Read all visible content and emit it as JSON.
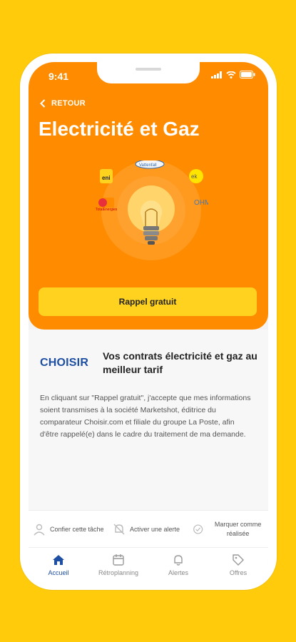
{
  "status_bar": {
    "time": "9:41"
  },
  "header": {
    "back_label": "RETOUR",
    "title": "Electricité et Gaz"
  },
  "illustration": {
    "icon": "lightbulb-icon",
    "logos": [
      "eni",
      "Vattenfall",
      "ekwateur",
      "TotalEnergies",
      "OHM"
    ]
  },
  "cta": {
    "label": "Rappel gratuit"
  },
  "offer": {
    "brand": "CHOISIR",
    "headline": "Vos contrats électricité et gaz au meilleur tarif",
    "legal": "En cliquant sur \"Rappel gratuit\", j'accepte que mes informations soient transmises à la société Marketshot, éditrice du comparateur Choisir.com et filiale du groupe La Poste, afin d'être rappelé(e) dans le cadre du traitement de ma demande."
  },
  "actions": [
    {
      "label": "Confier cette tâche",
      "icon": "person-icon"
    },
    {
      "label": "Activer une alerte",
      "icon": "bell-off-icon"
    },
    {
      "label": "Marquer comme réalisée",
      "icon": "check-circle-icon"
    }
  ],
  "tabs": [
    {
      "label": "Accueil",
      "icon": "home-icon",
      "active": true
    },
    {
      "label": "Rétroplanning",
      "icon": "calendar-icon",
      "active": false
    },
    {
      "label": "Alertes",
      "icon": "bell-icon",
      "active": false
    },
    {
      "label": "Offres",
      "icon": "tag-icon",
      "active": false
    }
  ],
  "colors": {
    "background": "#FFCB0A",
    "hero": "#FF8C00",
    "cta": "#FFD21F",
    "accent": "#1F4FA3"
  }
}
